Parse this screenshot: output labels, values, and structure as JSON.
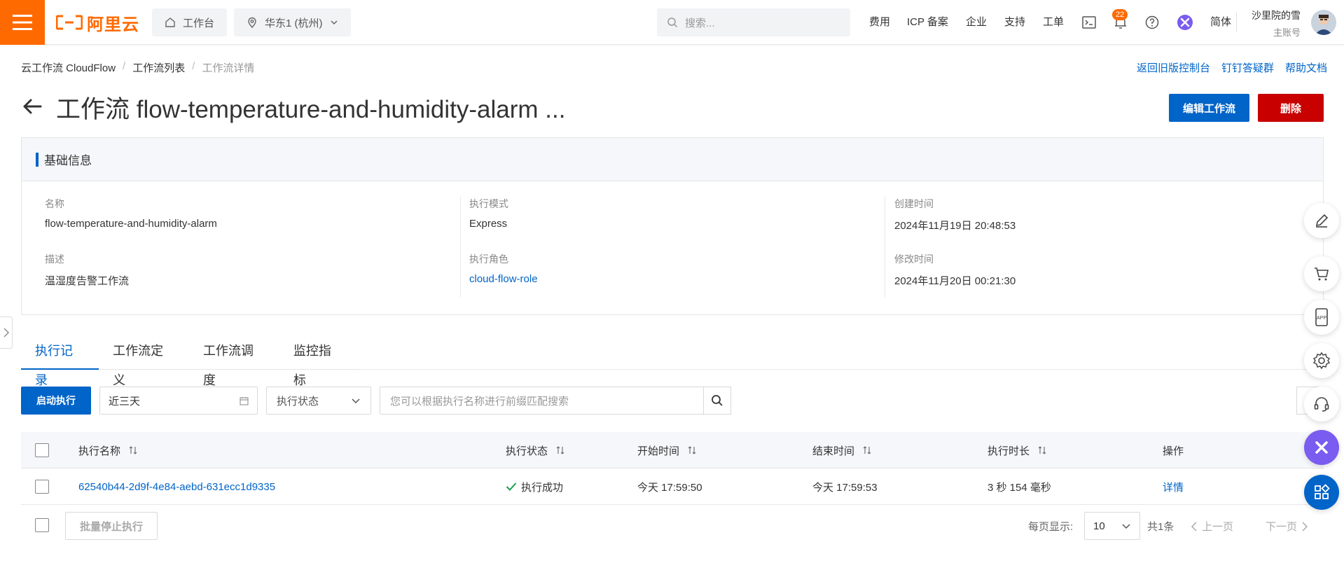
{
  "topbar": {
    "logo_text": "阿里云",
    "workbench": "工作台",
    "region": "华东1 (杭州)",
    "search_placeholder": "搜索...",
    "links": [
      "费用",
      "ICP 备案",
      "企业",
      "支持",
      "工单"
    ],
    "notification_count": "22",
    "language": "简体",
    "user_name": "沙里院的雪",
    "user_role": "主账号",
    "accent_color": "#ff6a00"
  },
  "breadcrumb": {
    "items": [
      "云工作流 CloudFlow",
      "工作流列表"
    ],
    "current": "工作流详情"
  },
  "header_links": [
    "返回旧版控制台",
    "钉钉答疑群",
    "帮助文档"
  ],
  "page": {
    "title": "工作流 flow-temperature-and-humidity-alarm ...",
    "edit_button": "编辑工作流",
    "delete_button": "删除"
  },
  "basic_info": {
    "title": "基础信息",
    "name_label": "名称",
    "name_value": "flow-temperature-and-humidity-alarm",
    "desc_label": "描述",
    "desc_value": "温湿度告警工作流",
    "mode_label": "执行模式",
    "mode_value": "Express",
    "role_label": "执行角色",
    "role_value": "cloud-flow-role",
    "created_label": "创建时间",
    "created_value": "2024年11月19日 20:48:53",
    "modified_label": "修改时间",
    "modified_value": "2024年11月20日 00:21:30"
  },
  "tabs": [
    "执行记录",
    "工作流定义",
    "工作流调度",
    "监控指标"
  ],
  "toolbar": {
    "start_button": "启动执行",
    "date_range": "近三天",
    "status_filter": "执行状态",
    "search_placeholder": "您可以根据执行名称进行前缀匹配搜索"
  },
  "table": {
    "headers": [
      "执行名称",
      "执行状态",
      "开始时间",
      "结束时间",
      "执行时长",
      "操作"
    ],
    "rows": [
      {
        "name": "62540b44-2d9f-4e84-aebd-631ecc1d9335",
        "status": "执行成功",
        "start": "今天 17:59:50",
        "end": "今天 17:59:53",
        "duration": "3 秒 154 毫秒",
        "action": "详情"
      }
    ]
  },
  "footer": {
    "batch_stop": "批量停止执行",
    "page_size_label": "每页显示:",
    "page_size": "10",
    "total": "共1条",
    "prev": "上一页",
    "next": "下一页"
  }
}
